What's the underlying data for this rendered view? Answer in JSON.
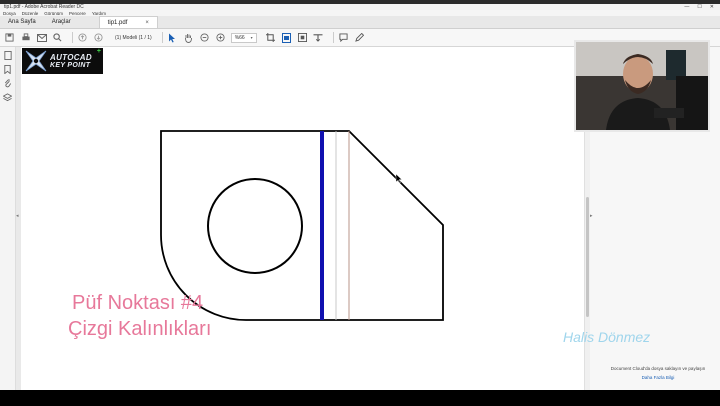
{
  "window": {
    "title": "tip1.pdf - Adobe Acrobat Reader DC",
    "controls": [
      "—",
      "☐",
      "✕"
    ]
  },
  "menubar": [
    "Dosya",
    "Düzenle",
    "Görünüm",
    "Pencere",
    "Yardım"
  ],
  "tabs": {
    "home": "Ana Sayfa",
    "tools": "Araçlar",
    "document": "tip1.pdf",
    "close_glyph": "×"
  },
  "toolbar": {
    "page_label": "(1) Modeli",
    "page_count": "(1 / 1)",
    "zoom": "%66"
  },
  "logo": {
    "line1": "AUTOCAD",
    "line2": "KEY POINT",
    "plus": "+"
  },
  "overlay": {
    "tip_title": "Püf Noktası #4",
    "tip_subtitle": "Çizgi Kalınlıkları",
    "watermark": "Halis Dönmez"
  },
  "right_panel": {
    "cloud_text": "Document Cloud'da dosya saklayın ve paylaşın",
    "cloud_link": "Daha Fazla Bilgi"
  },
  "colors": {
    "accent": "#1a5fb4",
    "heavy_line": "#1010b0",
    "tip_text": "#e7789a",
    "watermark": "#9fd5ec"
  }
}
